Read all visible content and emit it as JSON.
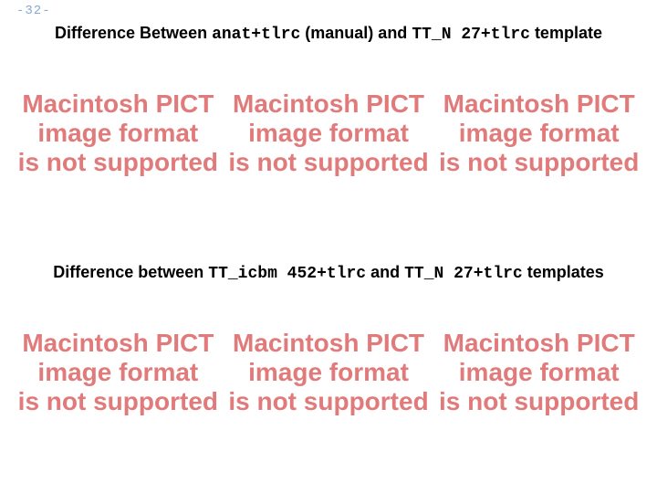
{
  "pageNumber": "-32-",
  "heading1": {
    "prefix": "Difference Between ",
    "code1": "anat+tlrc",
    "mid1": " (manual) and ",
    "code2": "TT_N 27+tlrc",
    "suffix": " template"
  },
  "heading2": {
    "prefix": "Difference between ",
    "code1": "TT_icbm 452+tlrc",
    "mid1": " and ",
    "code2": "TT_N 27+tlrc",
    "suffix": " templates"
  },
  "pict": {
    "line1": "Macintosh PICT",
    "line2": "image format",
    "line3": "is not supported"
  }
}
